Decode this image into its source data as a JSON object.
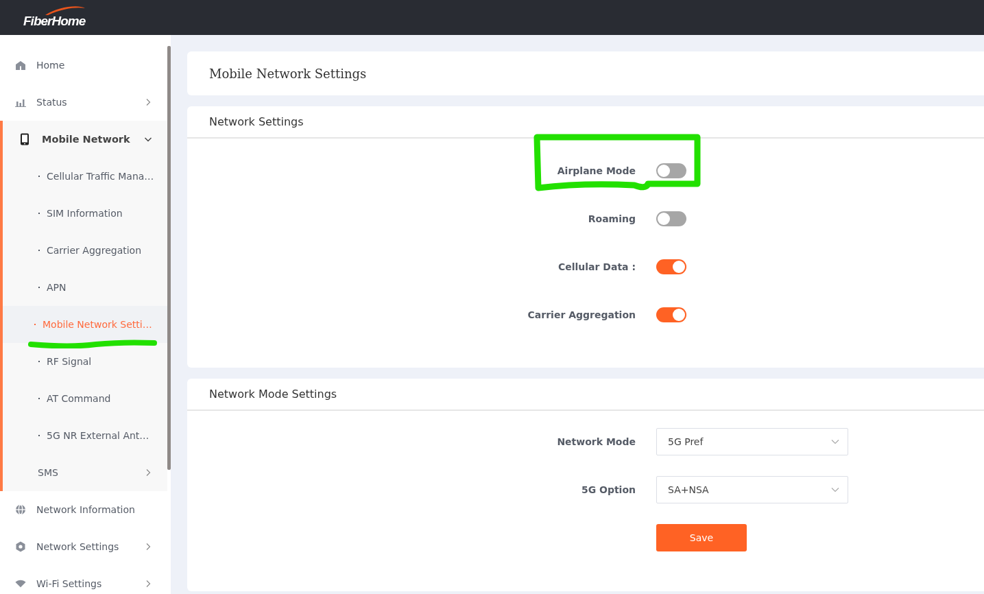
{
  "header": {
    "logo": "FiberHome"
  },
  "sidebar": {
    "items": [
      {
        "label": "Home",
        "expandable": false
      },
      {
        "label": "Status",
        "expandable": true
      },
      {
        "label": "Mobile Network",
        "expanded": true,
        "children": [
          {
            "label": "Cellular Traffic Mana…",
            "expandable": false,
            "selected": false
          },
          {
            "label": "SIM Information",
            "expandable": false,
            "selected": false
          },
          {
            "label": "Carrier Aggregation",
            "expandable": false,
            "selected": false
          },
          {
            "label": "APN",
            "expandable": false,
            "selected": false
          },
          {
            "label": "Mobile Network Setti…",
            "expandable": false,
            "selected": true
          },
          {
            "label": "RF Signal",
            "expandable": false,
            "selected": false
          },
          {
            "label": "AT Command",
            "expandable": false,
            "selected": false
          },
          {
            "label": "5G NR External Ant…",
            "expandable": false,
            "selected": false
          },
          {
            "label": "SMS",
            "expandable": true,
            "selected": false
          }
        ]
      },
      {
        "label": "Network Information",
        "expandable": false
      },
      {
        "label": "Network Settings",
        "expandable": true
      },
      {
        "label": "Wi-Fi Settings",
        "expandable": true
      }
    ]
  },
  "page_title": "Mobile Network Settings",
  "sections": [
    {
      "kind": "toggles",
      "title": "Network Settings",
      "rows": [
        {
          "label": "Airplane Mode",
          "on": false
        },
        {
          "label": "Roaming",
          "on": false
        },
        {
          "label": "Cellular Data :",
          "on": true
        },
        {
          "label": "Carrier Aggregation",
          "on": true
        }
      ]
    },
    {
      "kind": "form",
      "title": "Network Mode Settings",
      "fields": [
        {
          "label": "Network Mode",
          "value": "5G Pref"
        },
        {
          "label": "5G Option",
          "value": "SA+NSA"
        }
      ],
      "button": "Save"
    }
  ]
}
